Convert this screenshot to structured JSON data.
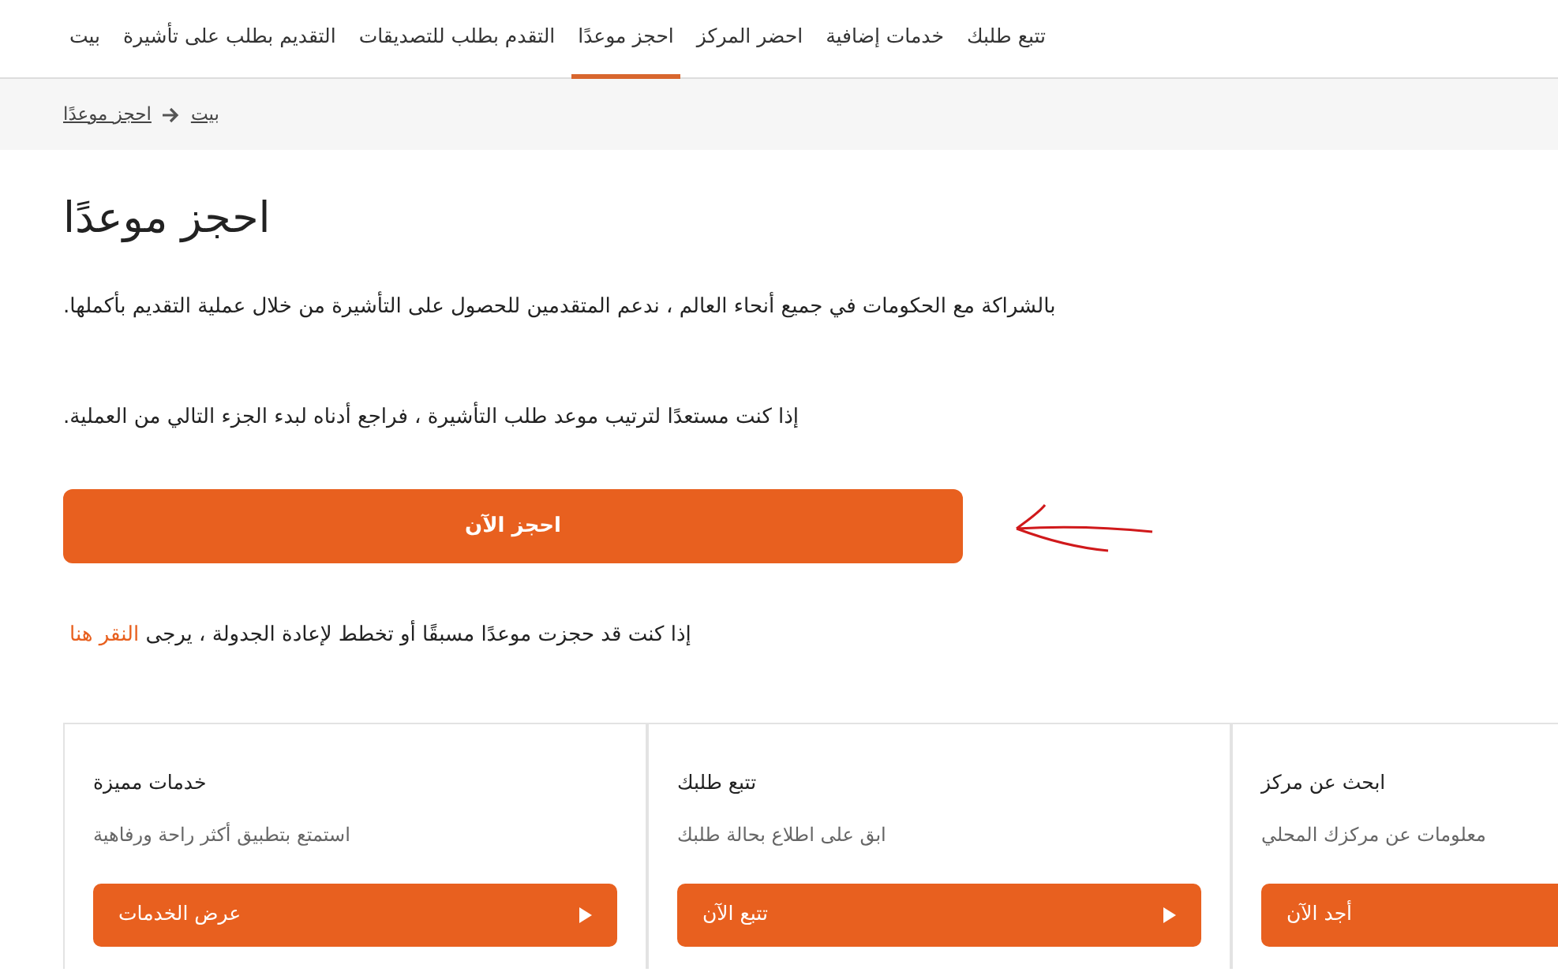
{
  "nav": [
    {
      "label": "تتبع طلبك",
      "selected": false
    },
    {
      "label": "خدمات إضافية",
      "selected": false
    },
    {
      "label": "احضر المركز",
      "selected": false
    },
    {
      "label": "احجز موعدًا",
      "selected": true
    },
    {
      "label": "التقدم بطلب للتصديقات",
      "selected": false
    },
    {
      "label": "التقديم بطلب على تأشيرة",
      "selected": false
    },
    {
      "label": "بيت",
      "selected": false
    }
  ],
  "breadcrumb": [
    "بيت",
    "احجز موعدًا"
  ],
  "title": "احجز موعدًا",
  "paragraphs": [
    ".بالشراكة مع الحكومات في جميع أنحاء العالم ، ندعم المتقدمين للحصول على التأشيرة من خلال عملية التقديم بأكملها",
    ".إذا كنت مستعدًا لترتيب موعد طلب التأشيرة ، فراجع أدناه لبدء الجزء التالي من العملية"
  ],
  "book_button": "احجز الآن",
  "reschedule": {
    "text": "إذا كنت قد حجزت موعدًا مسبقًا أو تخطط لإعادة الجدولة ، يرجى",
    "link": "النقر هنا"
  },
  "cards": [
    {
      "title": "ابحث عن مركز",
      "description": "معلومات عن مركزك المحلي",
      "button": "أجد الآن"
    },
    {
      "title": "تتبع طلبك",
      "description": "ابق على اطلاع بحالة طلبك",
      "button": "تتبع الآن"
    },
    {
      "title": "خدمات مميزة",
      "description": "استمتع بتطبيق أكثر راحة ورفاهية",
      "button": "عرض الخدمات"
    }
  ]
}
